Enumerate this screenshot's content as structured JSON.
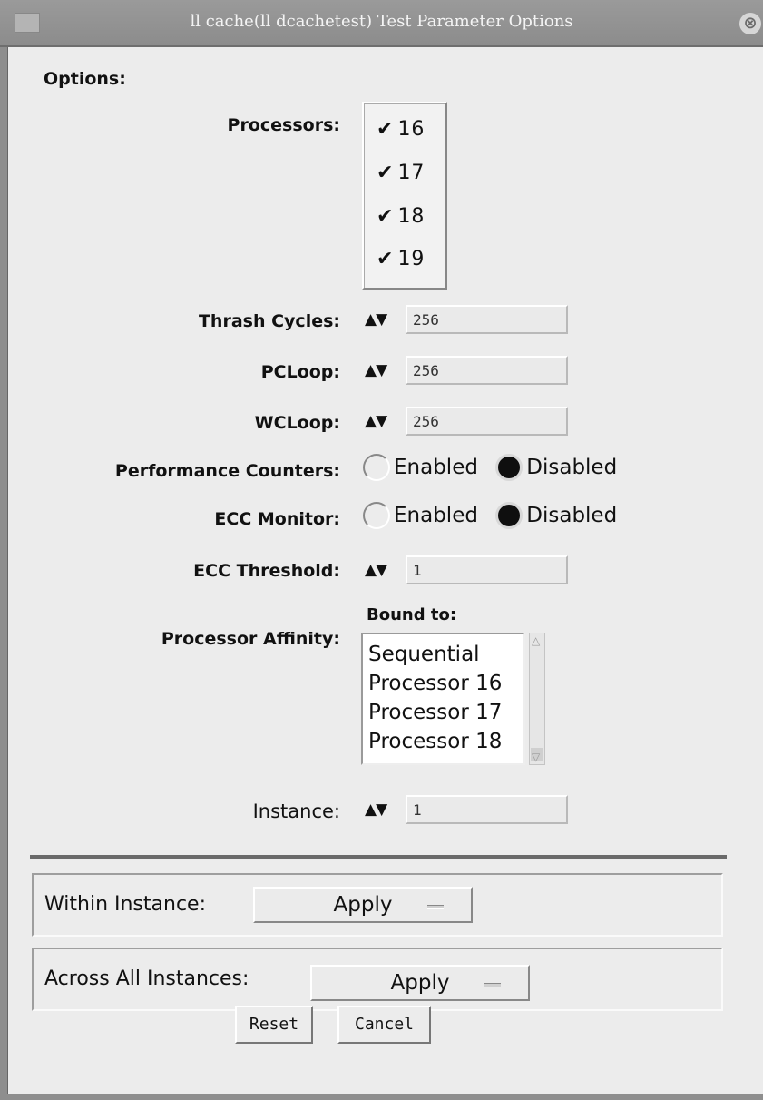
{
  "window": {
    "title": "ll cache(ll dcachetest) Test Parameter Options",
    "close_glyph": "⊗"
  },
  "options": {
    "heading": "Options:",
    "processors": {
      "label": "Processors:",
      "items": [
        {
          "label": "16",
          "checked": true
        },
        {
          "label": "17",
          "checked": true
        },
        {
          "label": "18",
          "checked": true
        },
        {
          "label": "19",
          "checked": true
        }
      ]
    },
    "thrash_cycles": {
      "label": "Thrash Cycles:",
      "value": "256"
    },
    "pcloop": {
      "label": "PCLoop:",
      "value": "256"
    },
    "wcloop": {
      "label": "WCLoop:",
      "value": "256"
    },
    "performance_counters": {
      "label": "Performance Counters:",
      "enabled_label": "Enabled",
      "disabled_label": "Disabled",
      "selected": "Disabled"
    },
    "ecc_monitor": {
      "label": "ECC Monitor:",
      "enabled_label": "Enabled",
      "disabled_label": "Disabled",
      "selected": "Disabled"
    },
    "ecc_threshold": {
      "label": "ECC Threshold:",
      "value": "1"
    },
    "processor_affinity": {
      "label": "Processor Affinity:",
      "bound_to_label": "Bound to:",
      "items": [
        "Sequential",
        "Processor 16",
        "Processor 17",
        "Processor 18"
      ]
    },
    "instance": {
      "label": "Instance:",
      "value": "1"
    },
    "spin_arrows": "▲▼"
  },
  "within_instance": {
    "label": "Within Instance:",
    "button": "Apply"
  },
  "across_all_instances": {
    "label": "Across All Instances:",
    "button": "Apply"
  },
  "buttons": {
    "reset": "Reset",
    "cancel": "Cancel"
  },
  "colors": {
    "titlebar": "#8c8c8c",
    "background": "#ececec",
    "radio_selected": "#0f0f0f"
  },
  "icons": {
    "check": "check-icon",
    "close": "close-icon",
    "spin": "spin-arrows-icon",
    "option_menu": "option-menu-icon"
  }
}
